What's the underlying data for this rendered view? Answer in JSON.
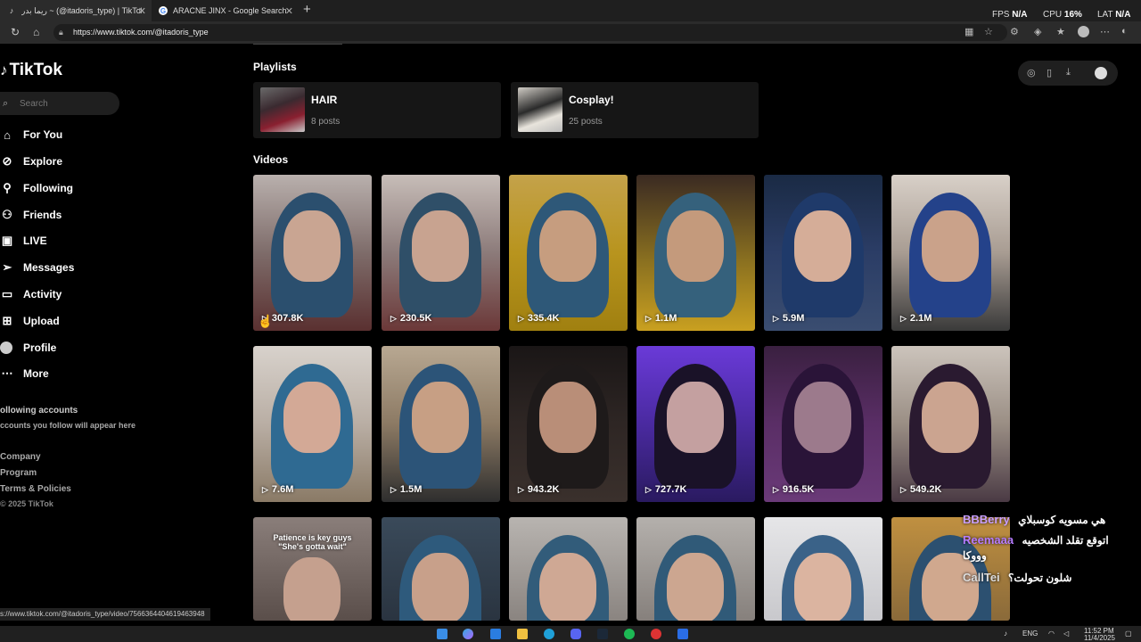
{
  "browser": {
    "tabs": [
      {
        "label": "ريما بدر ~ (@itadoris_type) | TikTok",
        "icon": "tiktok-icon"
      },
      {
        "label": "ARACNE JINX - Google Search",
        "icon": "google-icon"
      }
    ],
    "perf": {
      "fps_label": "FPS",
      "fps_value": "N/A",
      "cpu_label": "CPU",
      "cpu_value": "16%",
      "lat_label": "LAT",
      "lat_value": "N/A"
    },
    "url": "https://www.tiktok.com/@itadoris_type",
    "status_url": "s://www.tiktok.com/@itadoris_type/video/7566364404619463948"
  },
  "sidebar": {
    "logo": "TikTok",
    "search_placeholder": "Search",
    "items": [
      {
        "label": "For You",
        "icon": "home-icon"
      },
      {
        "label": "Explore",
        "icon": "compass-icon"
      },
      {
        "label": "Following",
        "icon": "user-plus-icon"
      },
      {
        "label": "Friends",
        "icon": "users-icon"
      },
      {
        "label": "LIVE",
        "icon": "live-icon"
      },
      {
        "label": "Messages",
        "icon": "send-icon"
      },
      {
        "label": "Activity",
        "icon": "message-icon"
      },
      {
        "label": "Upload",
        "icon": "plus-icon"
      },
      {
        "label": "Profile",
        "icon": "avatar-icon"
      },
      {
        "label": "More",
        "icon": "more-icon"
      }
    ],
    "following_heading": "ollowing accounts",
    "following_note": "ccounts you follow will appear here",
    "footer": [
      "Company",
      "Program",
      "Terms & Policies",
      "© 2025 TikTok"
    ]
  },
  "main": {
    "playlists_title": "Playlists",
    "playlists": [
      {
        "name": "HAIR",
        "count": "8 posts"
      },
      {
        "name": "Cosplay!",
        "count": "25 posts"
      }
    ],
    "videos_title": "Videos",
    "videos": [
      {
        "views": "307.8K"
      },
      {
        "views": "230.5K"
      },
      {
        "views": "335.4K"
      },
      {
        "views": "1.1M"
      },
      {
        "views": "5.9M"
      },
      {
        "views": "2.1M"
      },
      {
        "views": "7.6M"
      },
      {
        "views": "1.5M"
      },
      {
        "views": "943.2K"
      },
      {
        "views": "727.7K"
      },
      {
        "views": "916.5K"
      },
      {
        "views": "549.2K"
      },
      {
        "caption": "Patience is key guys \"She's gotta wait\""
      },
      {},
      {},
      {},
      {},
      {}
    ]
  },
  "chat": [
    {
      "user": "BBBerry",
      "text": "هي مسويه كوسبلاي",
      "color": "#c9a0ff"
    },
    {
      "user": "Reemaaa",
      "text": "اتوقع تقلد الشخصيه",
      "color": "#b57bff"
    },
    {
      "user": "",
      "text": "وووكا",
      "color": "#ffffff"
    },
    {
      "user": "CallTei",
      "text": "شلون تحولت؟",
      "color": "#dddddd"
    }
  ],
  "taskbar": {
    "lang": "ENG",
    "time": "11:52 PM",
    "date": "11/4/2025"
  }
}
